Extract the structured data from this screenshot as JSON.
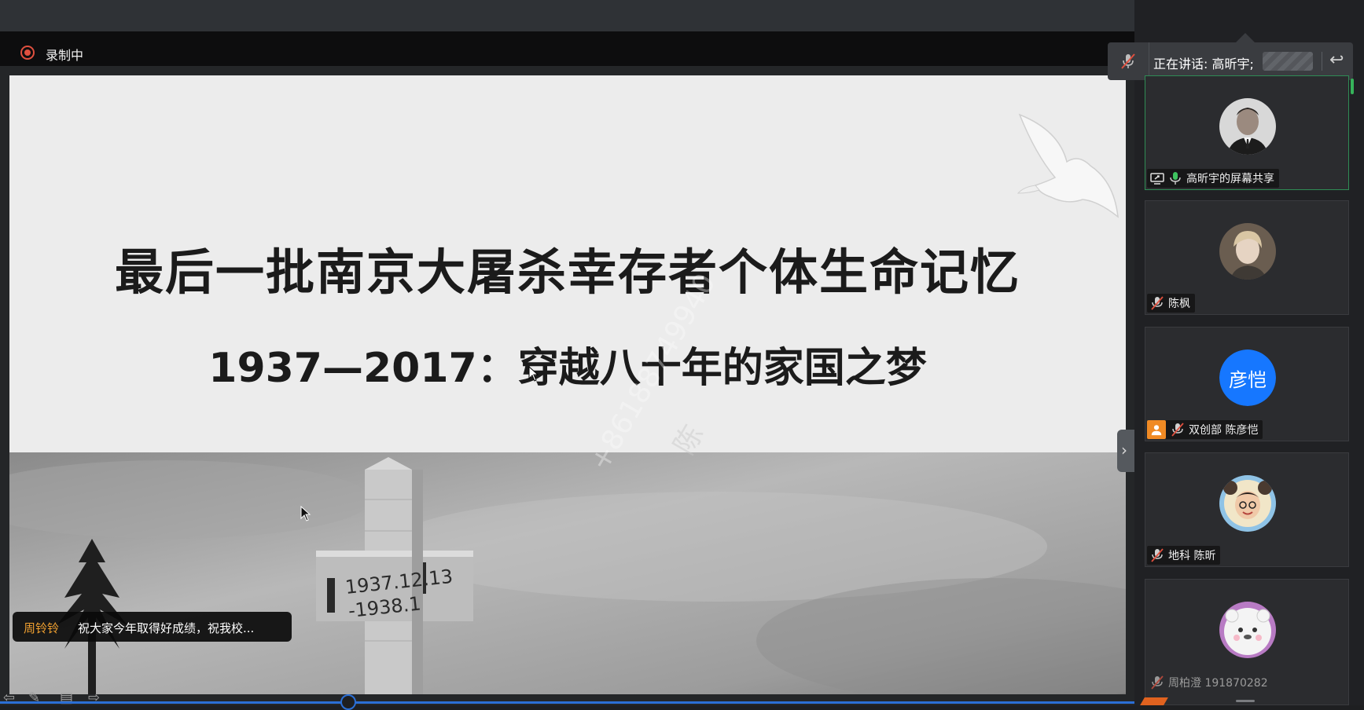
{
  "recording": {
    "label": "录制中"
  },
  "slide": {
    "title": "最后一批南京大屠杀幸存者个体生命记忆",
    "subtitle": "1937—2017：穿越八十年的家国之梦",
    "watermark_number": "+8618874",
    "watermark_number_tail": "9940",
    "watermark_name": "陈"
  },
  "chat": {
    "sender": "周铃铃",
    "message": "祝大家今年取得好成绩，祝我校..."
  },
  "speaking": {
    "text": "正在讲话: 高昕宇;",
    "back_icon": "reply-icon"
  },
  "participants": [
    {
      "name": "高昕宇的屏幕共享",
      "avatar": "photo",
      "mic": "on",
      "sharing": true
    },
    {
      "name": "陈枫",
      "avatar": "photo",
      "mic": "muted"
    },
    {
      "name": "双创部 陈彦恺",
      "avatar_text": "彦恺",
      "mic": "muted",
      "badge": "person-icon"
    },
    {
      "name": "地科 陈昕",
      "avatar": "photo",
      "mic": "muted"
    },
    {
      "name": "周柏澄 191870282",
      "avatar": "photo",
      "mic": "muted"
    }
  ],
  "colors": {
    "recording_red": "#e0503f",
    "chat_sender_orange": "#f0a030",
    "avatar_blue": "#1677ff",
    "active_border_green": "#2f8c55",
    "mic_on_green": "#3ec35f",
    "progress_blue": "#2b6fd6"
  }
}
